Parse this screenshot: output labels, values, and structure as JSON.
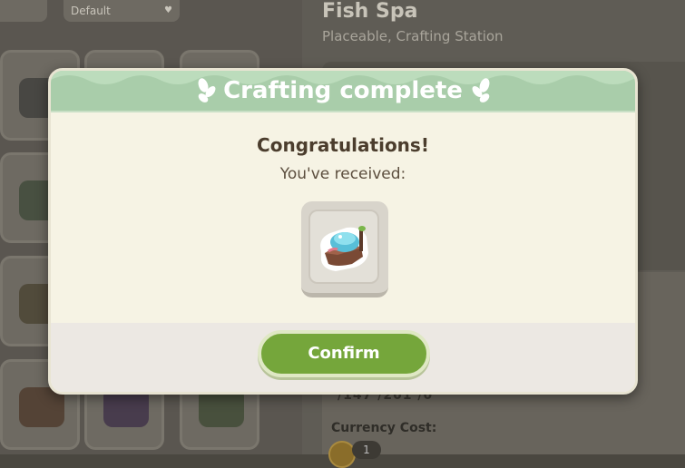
{
  "background": {
    "sort_dropdown": "Default",
    "item_name": "Fish Spa",
    "item_tags": "Placeable, Crafting Station",
    "partial_numbers": "/147    /201    /0",
    "currency_label": "Currency Cost:",
    "currency_qty": "1"
  },
  "modal": {
    "title": "Crafting complete",
    "congratulations": "Congratulations!",
    "received_label": "You've received:",
    "reward_item_icon": "fish-spa-item-icon",
    "confirm_label": "Confirm"
  },
  "colors": {
    "header_green": "#a9cdaa",
    "confirm_green": "#75a63b",
    "panel_cream": "#f6f3e4"
  }
}
